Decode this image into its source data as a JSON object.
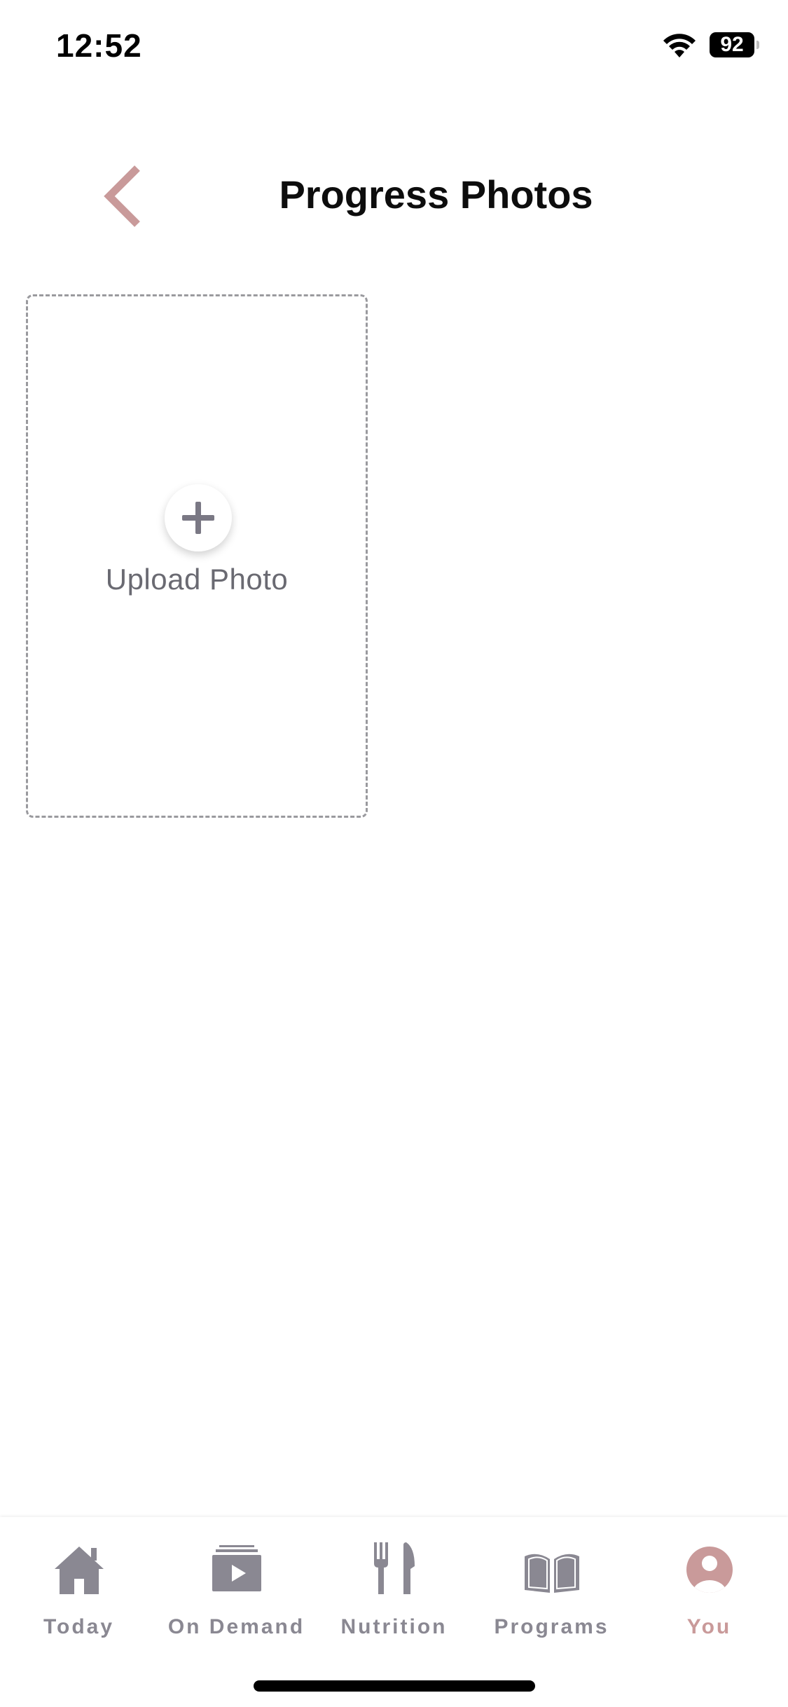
{
  "status_bar": {
    "time": "12:52",
    "battery_level": "92",
    "icons": [
      "wifi-icon",
      "battery-icon"
    ]
  },
  "header": {
    "title": "Progress Photos",
    "back_icon": "chevron-left-icon"
  },
  "upload": {
    "label": "Upload Photo",
    "icon": "plus-icon"
  },
  "tab_bar": {
    "active": "You",
    "items": [
      {
        "label": "Today",
        "icon": "home-icon"
      },
      {
        "label": "On Demand",
        "icon": "video-library-icon"
      },
      {
        "label": "Nutrition",
        "icon": "fork-knife-icon"
      },
      {
        "label": "Programs",
        "icon": "book-icon"
      },
      {
        "label": "You",
        "icon": "profile-icon"
      }
    ]
  },
  "colors": {
    "accent": "#c99a9a",
    "inactive_icon": "#8a8892",
    "border": "#9a9a9e",
    "text": "#0d0d0d"
  }
}
